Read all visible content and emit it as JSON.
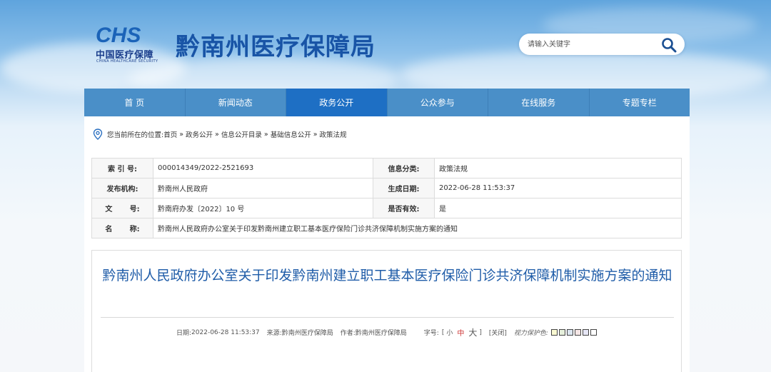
{
  "header": {
    "logo_text": "中国医疗保障",
    "logo_en": "CHINA HEALTHCARE SECURITY",
    "logo_mark": "CHS",
    "site_title": "黔南州医疗保障局",
    "search_placeholder": "请输入关键字",
    "search_icon": "search-icon"
  },
  "nav": {
    "items": [
      {
        "label": "首  页"
      },
      {
        "label": "新闻动态"
      },
      {
        "label": "政务公开",
        "active": true
      },
      {
        "label": "公众参与"
      },
      {
        "label": "在线服务"
      },
      {
        "label": "专题专栏"
      }
    ],
    "color": "#4a8fc8",
    "active_color": "#1e6fc4"
  },
  "breadcrumb": {
    "prefix": "您当前所在的位置:",
    "items": [
      "首页",
      "政务公开",
      "信息公开目录",
      "基础信息公开",
      "政策法规"
    ],
    "separator": "»"
  },
  "meta": {
    "index_label": "索 引 号:",
    "index_value": "000014349/2022-2521693",
    "category_label": "信息分类:",
    "category_value": "政策法规",
    "publisher_label": "发布机构:",
    "publisher_value": "黔南州人民政府",
    "created_label": "生成日期:",
    "created_value": "2022-06-28 11:53:37",
    "docno_label": "文       号:",
    "docno_value": "黔南府办发〔2022〕10 号",
    "valid_label": "是否有效:",
    "valid_value": "是",
    "name_label": "名       称:",
    "name_value": "黔南州人民政府办公室关于印发黔南州建立职工基本医疗保险门诊共济保障机制实施方案的通知"
  },
  "article": {
    "title": "黔南州人民政府办公室关于印发黔南州建立职工基本医疗保险门诊共济保障机制实施方案的通知",
    "date_label": "日期:",
    "date_value": "2022-06-28 11:53:37",
    "source_label": "来源:",
    "source_value": "黔南州医疗保障局",
    "author_label": "作者:",
    "author_value": "黔南州医疗保障局",
    "fontsize_label": "字号:",
    "fs_open": "[",
    "fs_small": "小",
    "fs_medium": "中",
    "fs_large": "大",
    "fs_close": "]",
    "close_label": "[关闭]",
    "eyecare_label": "视力保护色:",
    "eyecare_colors": [
      "#fafad2",
      "#e6f0dc",
      "#dce6f0",
      "#f5e6e6",
      "#e6e6f5",
      "#ffffff"
    ]
  }
}
